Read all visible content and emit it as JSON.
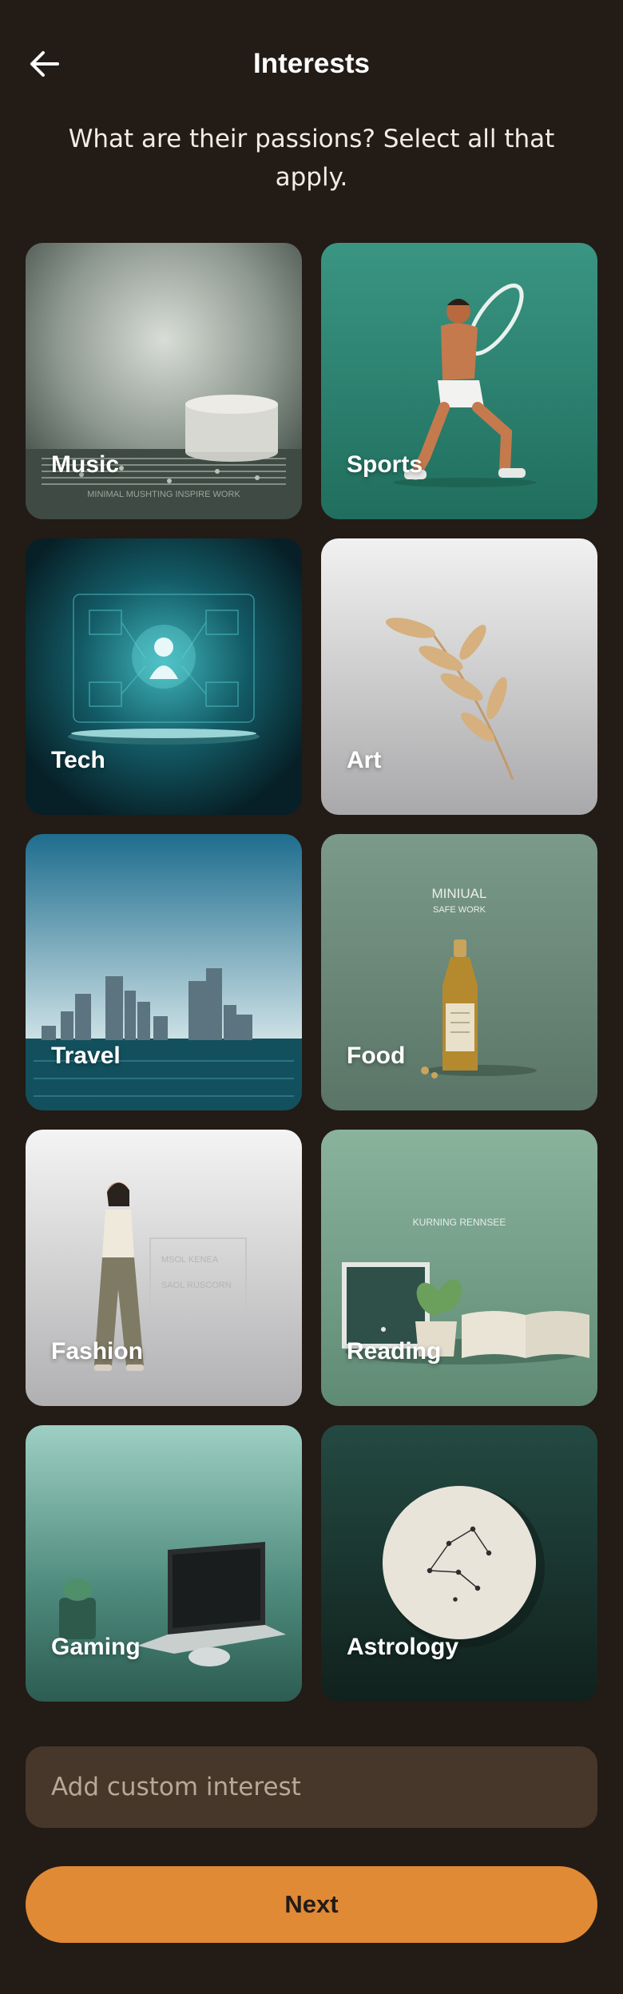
{
  "header": {
    "title": "Interests",
    "back_icon": "arrow-left-icon"
  },
  "subtitle": "What are their passions? Select all that apply.",
  "interests": [
    {
      "label": "Music",
      "image_text": "MINIMAL MUSHTING INSPIRE WORK"
    },
    {
      "label": "Sports"
    },
    {
      "label": "Tech"
    },
    {
      "label": "Art"
    },
    {
      "label": "Travel"
    },
    {
      "label": "Food",
      "image_title": "MINIUAL",
      "image_subtitle": "SAFE WORK"
    },
    {
      "label": "Fashion",
      "image_line1": "MSOL KENEA",
      "image_line2": "SAOL RUSCORN"
    },
    {
      "label": "Reading",
      "image_text": "KURNING RENNSEE"
    },
    {
      "label": "Gaming"
    },
    {
      "label": "Astrology"
    }
  ],
  "custom_input": {
    "placeholder": "Add custom interest",
    "value": ""
  },
  "next_button": {
    "label": "Next"
  },
  "colors": {
    "background": "#231b16",
    "accent": "#e08a36",
    "input_bg": "#46372a"
  }
}
